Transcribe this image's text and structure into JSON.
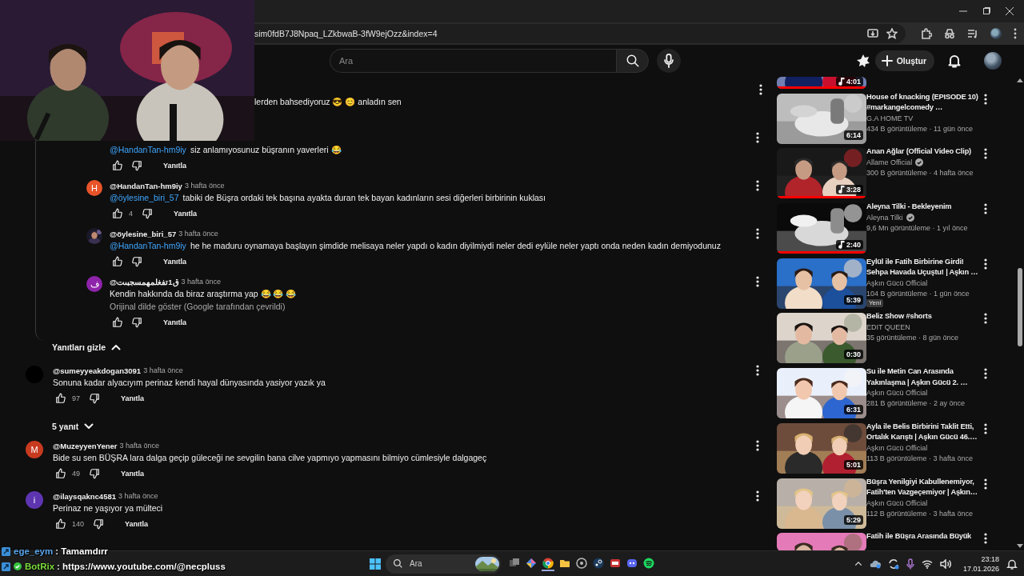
{
  "browser": {
    "url": "sim0fdB7J8Npaq_LZkbwaB-3fW9ejOzz&index=4"
  },
  "header": {
    "search": {
      "placeholder": "Ara"
    },
    "create_label": "Oluştur"
  },
  "comments": [
    {
      "kind": "partial",
      "text": "lerden bahsediyoruz 😎 😊 anladın sen"
    },
    {
      "kind": "reply",
      "mention": "@HandanTan-hm9iy",
      "text": "siz anlamıyosunuz büşranın yaverleri 😂",
      "reply_label": "Yanıtla"
    },
    {
      "kind": "reply",
      "author": "@HandanTan-hm9iy",
      "time": "3 hafta önce",
      "avatar": {
        "letter": "H",
        "color": "#e8542a"
      },
      "mention": "@öylesine_biri_57",
      "text": "tabiki de Büşra ordaki tek başına ayakta duran tek bayan kadınların sesi diğerleri birbirinin kuklası",
      "likes": "4",
      "reply_label": "Yanıtla"
    },
    {
      "kind": "reply",
      "author": "@öylesine_biri_57",
      "time": "3 hafta önce",
      "mention": "@HandanTan-hm9iy",
      "text": "he he maduru oynamaya başlayın şimdide melisaya neler yapdı o kadın diyilmiydi neler dedi eylüle neler yaptı onda neden kadın demiyodunuz",
      "reply_label": "Yanıtla"
    },
    {
      "kind": "reply",
      "author": "@ق1تفغلمهمسجبىت",
      "time": "3 hafta önce",
      "avatar": {
        "letter": "ف",
        "color": "#8e24aa"
      },
      "text": "Kendin hakkında da biraz araştırma yap 😂 😂 😂",
      "translation": "Orijinal dilde göster (Google tarafından çevrildi)",
      "reply_label": "Yanıtla"
    },
    {
      "kind": "toggle",
      "label": "Yanıtları gizle",
      "expanded": true
    },
    {
      "kind": "comment",
      "author": "@sumeyyeakdogan3091",
      "time": "3 hafta önce",
      "avatar": {
        "color": "#000000"
      },
      "text": "Sonuna kadar alyacıyım perinaz kendi hayal dünyasında yasiyor yazık ya",
      "likes": "97",
      "reply_label": "Yanıtla"
    },
    {
      "kind": "toggle",
      "label": "5 yanıt",
      "expanded": false
    },
    {
      "kind": "comment",
      "author": "@MuzeyyenYener",
      "time": "3 hafta önce",
      "avatar": {
        "letter": "M",
        "color": "#c73a1f"
      },
      "text": "Bide su sen BÜŞRA lara dalga geçip güleceği ne sevgilin bana cilve yapmıyo yapmasını bilmiyo cümlesiyle dalgageç",
      "likes": "49",
      "reply_label": "Yanıtla"
    },
    {
      "kind": "comment",
      "author": "@ilaysqaknc4581",
      "time": "3 hafta önce",
      "avatar": {
        "letter": "i",
        "color": "#5e35b1"
      },
      "text": "Perinaz ne yaşıyor ya mülteci",
      "likes": "140",
      "reply_label": "Yanıtla"
    }
  ],
  "videos": [
    {
      "kind": "partial",
      "duration": "4:01",
      "music": true,
      "level": 1
    },
    {
      "title": "House of knacking (EPISODE 10) #markangelcomedy …",
      "channel": "G.A HOME TV",
      "verified": false,
      "meta": "434 B görüntüleme · 11 gün önce",
      "duration": "6:14",
      "music": false
    },
    {
      "title": "Anan Ağlar (Official Video Clip)",
      "channel": "Allame Official",
      "verified": true,
      "meta": "300 B görüntüleme · 4 hafta önce",
      "duration": "3:28",
      "music": true,
      "level": 1
    },
    {
      "title": "Aleyna Tilki - Bekleyenim",
      "channel": "Aleyna Tilki",
      "verified": true,
      "meta": "9,6 Mn görüntüleme · 1 yıl önce",
      "duration": "2:40",
      "music": true,
      "level": 1
    },
    {
      "title": "Eylül ile Fatih Birbirine Girdi! Sehpa Havada Uçuştu! | Aşkın …",
      "channel": "Aşkın Gücü Official",
      "verified": false,
      "meta": "104 B görüntüleme · 1 gün önce",
      "badge": "Yeni",
      "duration": "5:39",
      "music": false
    },
    {
      "title": "Beliz Show #shorts",
      "channel": "EDIT QUEEN",
      "verified": false,
      "meta": "35 görüntüleme · 8 gün önce",
      "duration": "0:30",
      "music": false
    },
    {
      "title": "Su ile Metin Can Arasında Yakınlaşma | Aşkın Gücü 2. …",
      "channel": "Aşkın Gücü Official",
      "verified": false,
      "meta": "281 B görüntüleme · 2 ay önce",
      "duration": "6:31",
      "music": false
    },
    {
      "title": "Ayla ile Belis Birbirini Taklit Etti, Ortalık Karıştı | Aşkın Gücü 46.…",
      "channel": "Aşkın Gücü Official",
      "verified": false,
      "meta": "113 B görüntüleme · 3 hafta önce",
      "duration": "5:01",
      "music": false
    },
    {
      "title": "Büşra Yenilgiyi Kabullenemiyor, Fatih'ten Vazgeçemiyor | Aşkın…",
      "channel": "Aşkın Gücü Official",
      "verified": false,
      "meta": "112 B görüntüleme · 3 hafta önce",
      "duration": "5:29",
      "music": false
    },
    {
      "kind": "cut",
      "title": "Fatih ile Büşra Arasında Büyük"
    }
  ],
  "taskbar": {
    "search": {
      "placeholder": "Ara"
    },
    "time": "23:18",
    "date": "17.01.2026"
  },
  "chat": [
    {
      "user": "ege_eym",
      "color": "#5aa6ec",
      "message": ": Tamamdırr",
      "verified": false
    },
    {
      "user": "BotRix",
      "color": "#7cdc3c",
      "message": ": https://www.youtube.com/@necpluss",
      "verified": true
    }
  ]
}
